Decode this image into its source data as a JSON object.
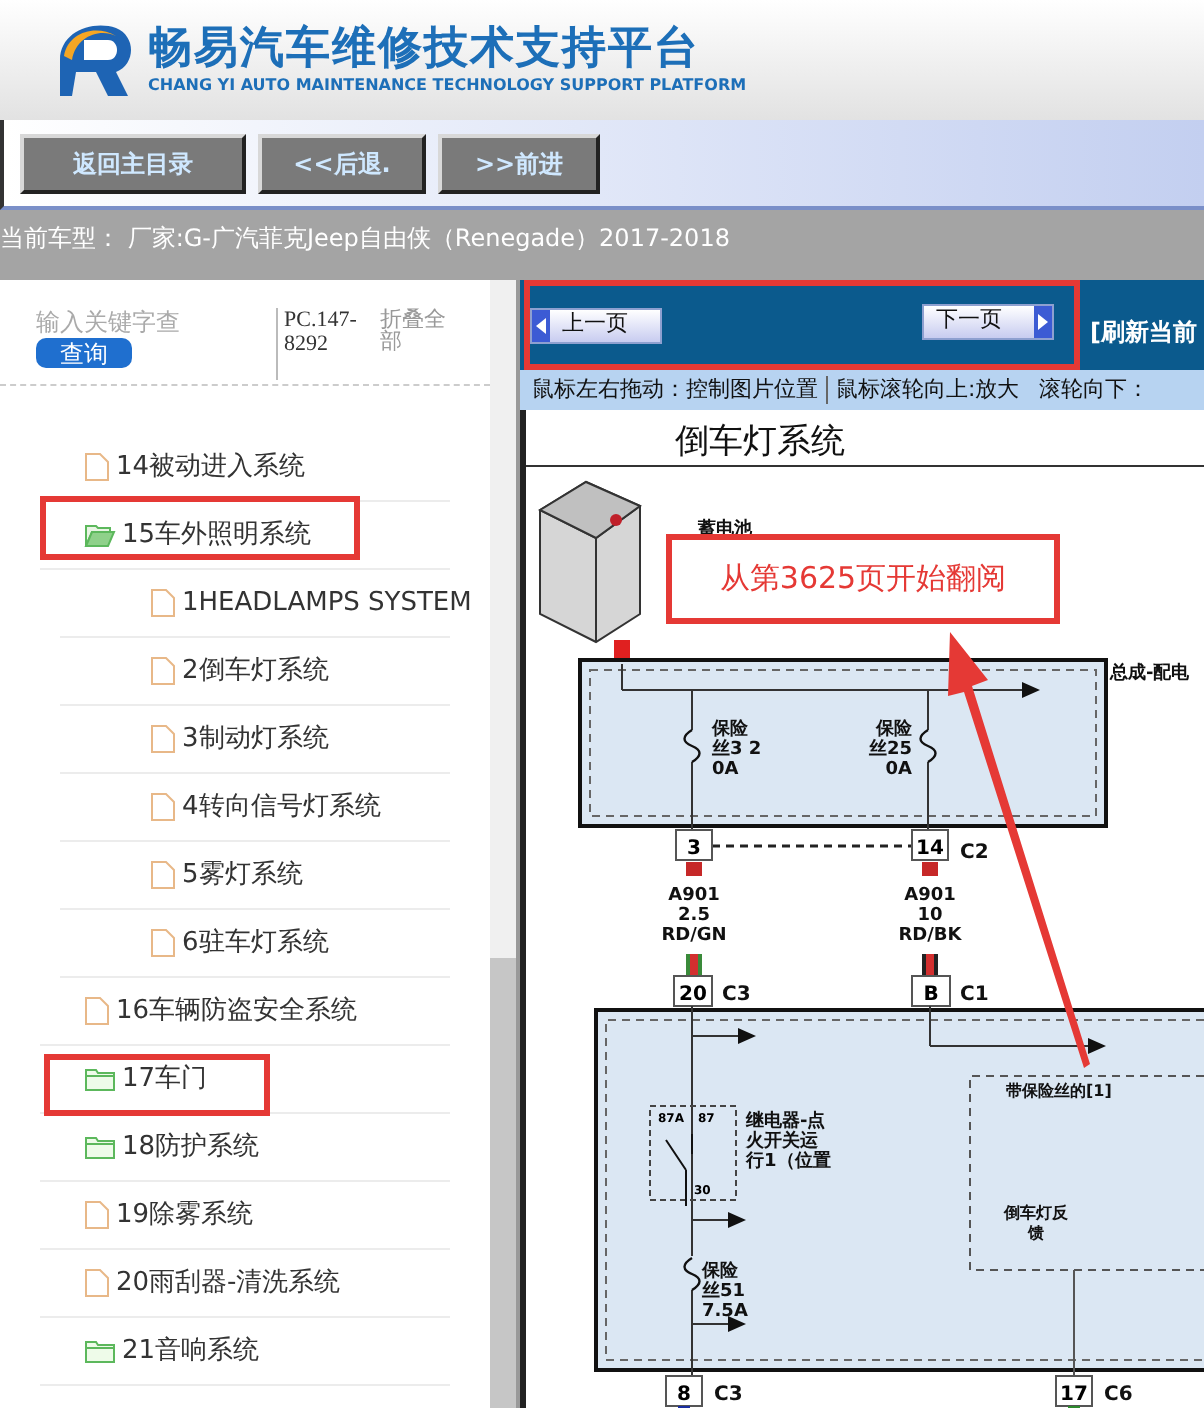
{
  "header": {
    "title": "畅易汽车维修技术支持平台",
    "subtitle": "CHANG YI AUTO MAINTENANCE TECHNOLOGY SUPPORT PLATFORM"
  },
  "nav_buttons": [
    "返回主目录",
    "<<后退.",
    ">>前进"
  ],
  "current_model": "当前车型： 厂家:G-广汽菲克Jeep自由侠（Renegade）2017-2018",
  "search": {
    "placeholder": "输入关键字查",
    "button": "查询"
  },
  "code": "PC.147-8292",
  "collapse_all": "折叠全部",
  "tree": [
    {
      "label": "14被动进入系统",
      "kind": "file"
    },
    {
      "label": "15车外照明系统",
      "kind": "folder",
      "expanded": true,
      "children": [
        {
          "label": "1HEADLAMPS SYSTEM",
          "kind": "file"
        },
        {
          "label": "2倒车灯系统",
          "kind": "file"
        },
        {
          "label": "3制动灯系统",
          "kind": "file"
        },
        {
          "label": "4转向信号灯系统",
          "kind": "file"
        },
        {
          "label": "5雾灯系统",
          "kind": "file"
        },
        {
          "label": "6驻车灯系统",
          "kind": "file"
        }
      ]
    },
    {
      "label": "16车辆防盗安全系统",
      "kind": "file"
    },
    {
      "label": "17车门",
      "kind": "folder",
      "expanded": false
    },
    {
      "label": "18防护系统",
      "kind": "folder",
      "expanded": false
    },
    {
      "label": "19除雾系统",
      "kind": "file"
    },
    {
      "label": "20雨刮器-清洗系统",
      "kind": "file"
    },
    {
      "label": "21音响系统",
      "kind": "folder",
      "expanded": false
    }
  ],
  "viewer": {
    "prev": "上一页",
    "next": "下一页",
    "refresh": "[刷新当前",
    "hints": [
      "鼠标左右拖动：控制图片位置",
      "鼠标滚轮向上:放大",
      "滚轮向下："
    ]
  },
  "diagram": {
    "title": "倒车灯系统",
    "battery": "蓄电池",
    "module_top": "总成-配电",
    "fuses_top": [
      {
        "lines": [
          "保险",
          "丝3 2",
          "0A"
        ]
      },
      {
        "lines": [
          "保险",
          "丝25",
          "0A"
        ]
      }
    ],
    "connectors_mid": [
      {
        "pin": "3"
      },
      {
        "pin": "14",
        "name": "C2"
      }
    ],
    "wires": [
      {
        "lines": [
          "A901",
          "2.5",
          "RD/GN"
        ]
      },
      {
        "lines": [
          "A901",
          "10",
          "RD/BK"
        ]
      }
    ],
    "connectors_lower": [
      {
        "pin": "20",
        "name": "C3"
      },
      {
        "pin": "B",
        "name": "C1"
      }
    ],
    "relay": {
      "lines": [
        "继电器-点",
        "火开关运",
        "行1（位置"
      ],
      "pins": [
        "87A",
        "87",
        "30"
      ]
    },
    "fuse_lower": {
      "lines": [
        "保险",
        "丝51",
        "7.5A"
      ]
    },
    "fused_label": "带保险丝的[1]",
    "feedback_label": [
      "倒车灯反",
      "馈"
    ],
    "connectors_bottom": [
      {
        "pin": "8",
        "name": "C3"
      },
      {
        "pin": "17",
        "name": "C6"
      }
    ]
  },
  "callout": "从第3625页开始翻阅"
}
